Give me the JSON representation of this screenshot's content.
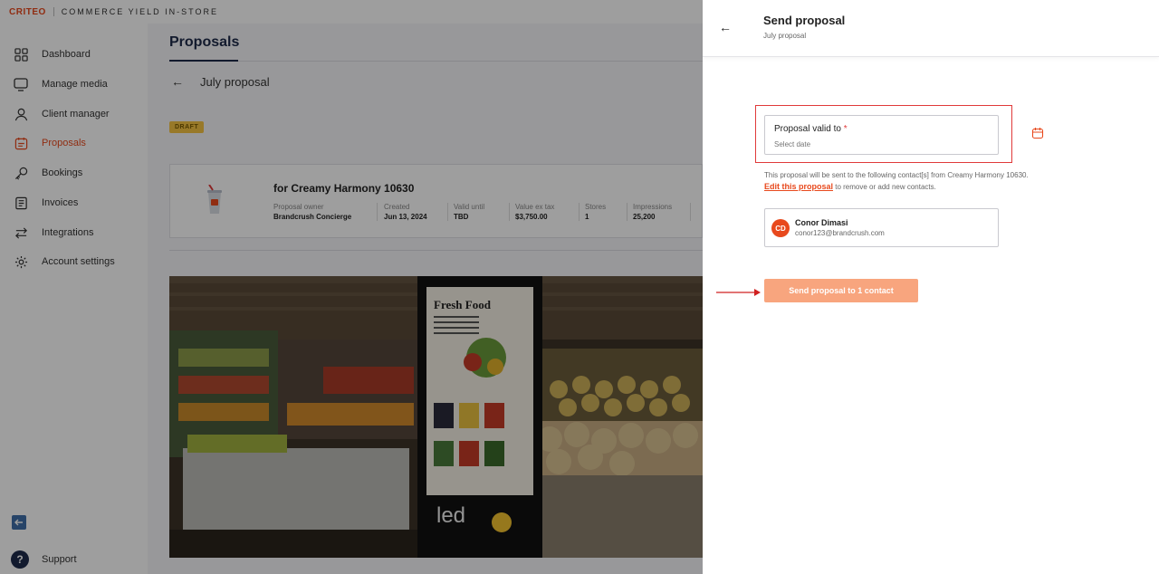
{
  "topbar": {
    "brand": "CRITEO",
    "product": "COMMERCE YIELD IN-STORE"
  },
  "sidebar": {
    "items": [
      {
        "label": "Dashboard",
        "icon": "dashboard-icon"
      },
      {
        "label": "Manage media",
        "icon": "monitor-icon"
      },
      {
        "label": "Client manager",
        "icon": "user-icon"
      },
      {
        "label": "Proposals",
        "icon": "proposals-icon",
        "active": true
      },
      {
        "label": "Bookings",
        "icon": "key-icon"
      },
      {
        "label": "Invoices",
        "icon": "invoice-icon"
      },
      {
        "label": "Integrations",
        "icon": "swap-arrows-icon"
      },
      {
        "label": "Account settings",
        "icon": "gear-icon"
      }
    ],
    "support": "Support"
  },
  "main": {
    "title": "Proposals",
    "back_label": "July proposal",
    "badge": "DRAFT",
    "client_name": "for Creamy Harmony 10630",
    "meta": [
      {
        "label": "Proposal owner",
        "value": "Brandcrush Concierge"
      },
      {
        "label": "Created",
        "value": "Jun 13, 2024"
      },
      {
        "label": "Valid until",
        "value": "TBD"
      },
      {
        "label": "Value ex tax",
        "value": "$3,750.00"
      },
      {
        "label": "Stores",
        "value": "1"
      },
      {
        "label": "Impressions",
        "value": "25,200"
      }
    ],
    "hero_sign": {
      "title": "Fresh Food",
      "brand": "led"
    }
  },
  "panel": {
    "title": "Send proposal",
    "subtitle": "July proposal",
    "date_label": "Proposal valid to",
    "required_mark": "*",
    "date_placeholder": "Select date",
    "info_line1": "This proposal will be sent to the following contact[s] from Creamy Harmony 10630.",
    "edit_link": "Edit this proposal",
    "info_line2_rest": " to remove or add new contacts.",
    "contact": {
      "initials": "CD",
      "name": "Conor Dimasi",
      "email": "conor123@brandcrush.com"
    },
    "send_button": "Send proposal to 1 contact"
  },
  "colors": {
    "accent": "#e8491d",
    "button": "#f8a57e",
    "highlight": "#e03a3a"
  }
}
